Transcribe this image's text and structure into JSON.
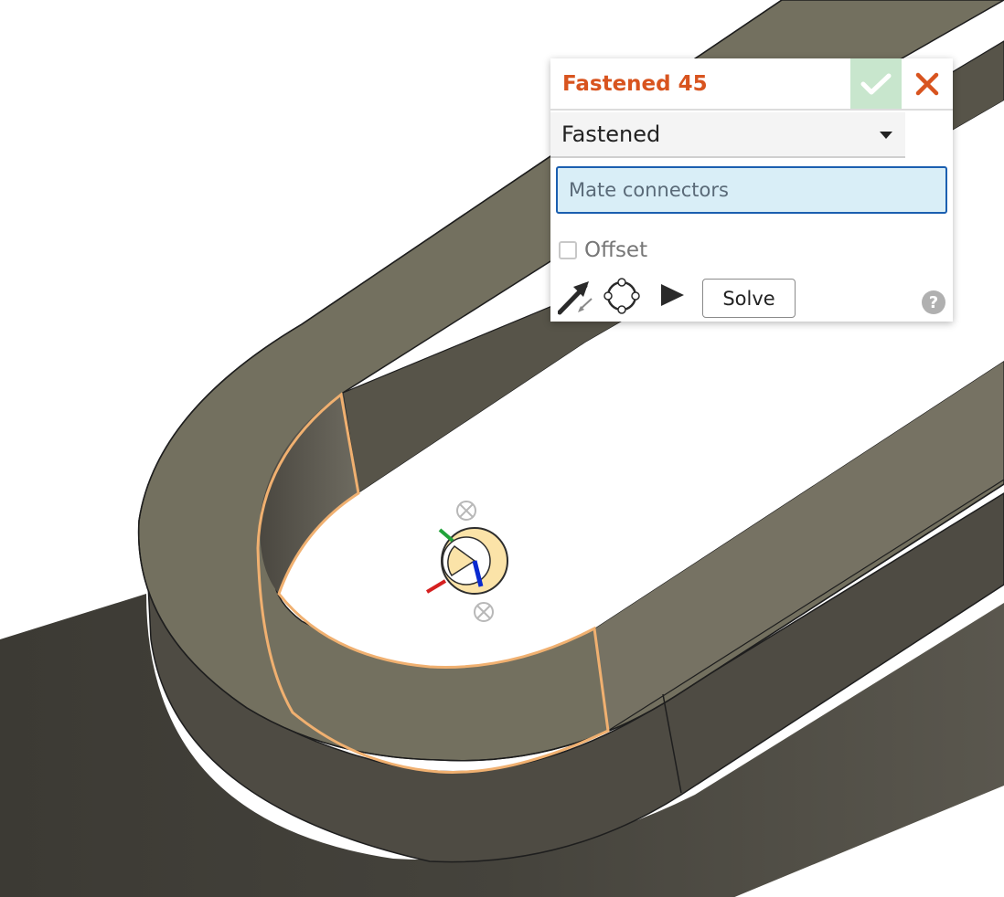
{
  "dialog": {
    "title": "Fastened 45",
    "accept_icon": "checkmark-icon",
    "cancel_icon": "close-x-icon",
    "mate_type": {
      "selected": "Fastened",
      "icon": "dropdown-caret-icon"
    },
    "mate_connectors": {
      "placeholder": "Mate connectors"
    },
    "offset": {
      "label": "Offset",
      "checked": false
    },
    "tools": [
      {
        "name": "flip-primary-axis",
        "icon": "flip-arrow-icon"
      },
      {
        "name": "reorient-secondary-axis",
        "icon": "rotate-circle-icon"
      },
      {
        "name": "animate",
        "icon": "play-icon"
      }
    ],
    "solve_label": "Solve",
    "help_icon": "help-question-icon",
    "help_glyph": "?"
  },
  "colors": {
    "title_accent": "#d8541f",
    "accept_bg": "#c8e6cd",
    "input_bg": "#d9eef7",
    "input_border": "#1b5fb0",
    "part_face": "#706d62",
    "part_side": "#4a4740",
    "selection_outline": "#f0b070"
  }
}
